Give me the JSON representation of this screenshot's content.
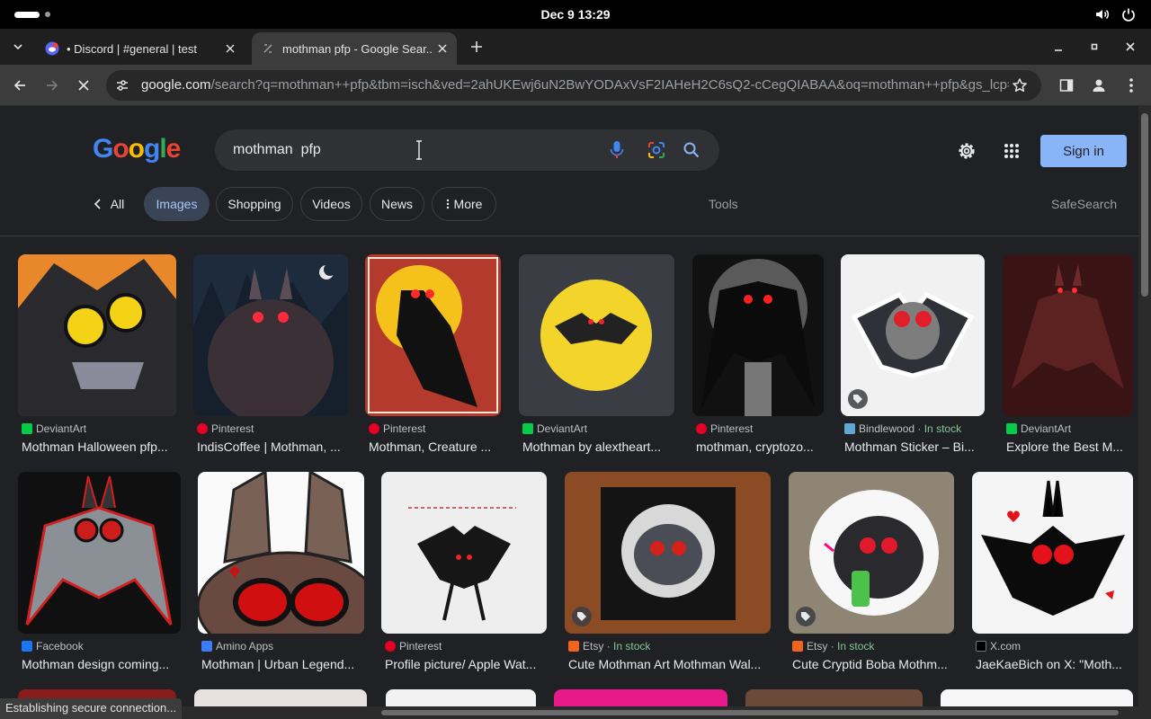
{
  "system": {
    "clock": "Dec 9  13:29"
  },
  "tabs": [
    {
      "title": "• Discord | #general | test"
    },
    {
      "title": "mothman pfp - Google Sear..."
    }
  ],
  "omnibox": {
    "host": "google.com",
    "path": "/search?q=mothman++pfp&tbm=isch&ved=2ahUKEwj6uN2BwYODAxVsF2IAHeH2C6sQ2-cCegQIABAA&oq=mothman++pfp&gs_lcp=..."
  },
  "search": {
    "query": "mothman  pfp"
  },
  "logo": {
    "letters": [
      "G",
      "o",
      "o",
      "g",
      "l",
      "e"
    ],
    "colors": [
      "#4285f4",
      "#ea4335",
      "#fbbc05",
      "#4285f4",
      "#34a853",
      "#ea4335"
    ]
  },
  "header": {
    "sign_in": "Sign in"
  },
  "chips": {
    "all": "All",
    "images": "Images",
    "shopping": "Shopping",
    "videos": "Videos",
    "news": "News",
    "more": "More",
    "tools": "Tools",
    "safesearch": "SafeSearch"
  },
  "results": [
    {
      "source": "DeviantArt",
      "title": "Mothman Halloween pfp...",
      "icon": "deviantart-icon",
      "icon_color": "#05cc47"
    },
    {
      "source": "Pinterest",
      "title": "IndisCoffee | Mothman, ...",
      "icon": "pinterest-icon",
      "icon_color": "#e60023"
    },
    {
      "source": "Pinterest",
      "title": "Mothman, Creature ...",
      "icon": "pinterest-icon",
      "icon_color": "#e60023"
    },
    {
      "source": "DeviantArt",
      "title": "Mothman by alextheart...",
      "icon": "deviantart-icon",
      "icon_color": "#05cc47"
    },
    {
      "source": "Pinterest",
      "title": "mothman, cryptozo...",
      "icon": "pinterest-icon",
      "icon_color": "#e60023"
    },
    {
      "source": "Bindlewood",
      "stock": "· In stock",
      "title": "Mothman Sticker – Bi...",
      "icon": "bindlewood-icon",
      "icon_color": "#5fa8d3"
    },
    {
      "source": "DeviantArt",
      "title": "Explore the Best M...",
      "icon": "deviantart-icon",
      "icon_color": "#05cc47"
    },
    {
      "source": "Facebook",
      "title": "Mothman design coming...",
      "icon": "facebook-icon",
      "icon_color": "#1877f2"
    },
    {
      "source": "Amino Apps",
      "title": "Mothman | Urban Legend...",
      "icon": "amino-icon",
      "icon_color": "#3d7bf7"
    },
    {
      "source": "Pinterest",
      "title": "Profile picture/ Apple Wat...",
      "icon": "pinterest-icon",
      "icon_color": "#e60023"
    },
    {
      "source": "Etsy",
      "stock": "· In stock",
      "title": "Cute Mothman Art Mothman Wal...",
      "icon": "etsy-icon",
      "icon_color": "#f1641e"
    },
    {
      "source": "Etsy",
      "stock": "· In stock",
      "title": "Cute Cryptid Boba Mothm...",
      "icon": "etsy-icon",
      "icon_color": "#f1641e"
    },
    {
      "source": "X.com",
      "title": "JaeKaeBich on X: \"Moth...",
      "icon": "x-icon",
      "icon_color": "#000000"
    }
  ],
  "status_text": "Establishing secure connection..."
}
